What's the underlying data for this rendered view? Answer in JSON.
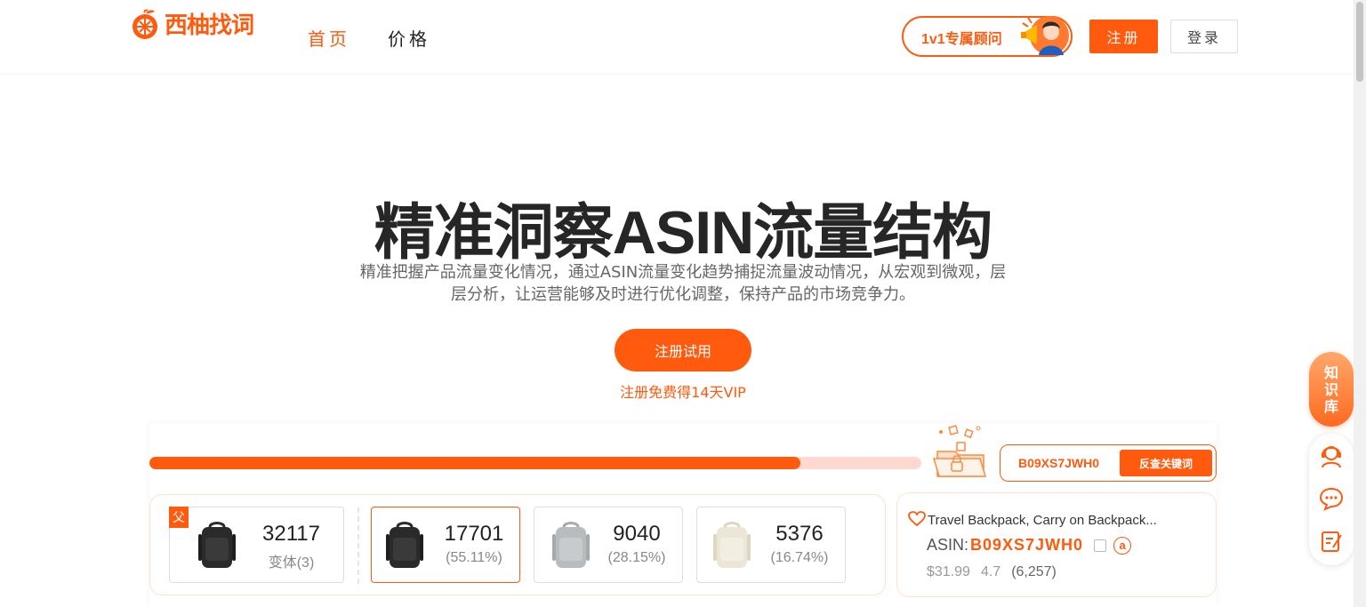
{
  "header": {
    "logo_text": "西柚找词",
    "nav": [
      {
        "label": "首页",
        "active": true
      },
      {
        "label": "价格",
        "active": false
      }
    ],
    "consult_label": "1v1专属顾问",
    "register_label": "注册",
    "login_label": "登录"
  },
  "hero": {
    "title": "精准洞察ASIN流量结构",
    "description": "精准把握产品流量变化情况，通过ASIN流量变化趋势捕捉流量波动情况，从宏观到微观，层层分析，让运营能够及时进行优化调整，保持产品的市场竞争力。",
    "cta_label": "注册试用",
    "cta_note": "注册免费得14天VIP"
  },
  "demo": {
    "progress_fraction": 0.843,
    "search_value": "B09XS7JWH0",
    "search_button": "反查关键词",
    "parent_badge": "父",
    "variants": [
      {
        "value": "32117",
        "sub": "变体(3)",
        "color": "dark"
      },
      {
        "value": "17701",
        "sub": "(55.11%)",
        "color": "dark",
        "selected": true
      },
      {
        "value": "9040",
        "sub": "(28.15%)",
        "color": "gray"
      },
      {
        "value": "5376",
        "sub": "(16.74%)",
        "color": "cream"
      }
    ],
    "product": {
      "title": "Travel Backpack, Carry on Backpack...",
      "asin_label": "ASIN:",
      "asin_value": "B09XS7JWH0",
      "amazon_glyph": "a",
      "price": "$31.99",
      "rating": "4.7",
      "reviews": "(6,257)"
    }
  },
  "side": {
    "knowledge_label": [
      "知",
      "识",
      "库"
    ],
    "tools": [
      "customer-service-icon",
      "chat-icon",
      "feedback-icon"
    ]
  },
  "colors": {
    "accent": "#ff5a0d",
    "accent_light": "#ffd9cf"
  }
}
